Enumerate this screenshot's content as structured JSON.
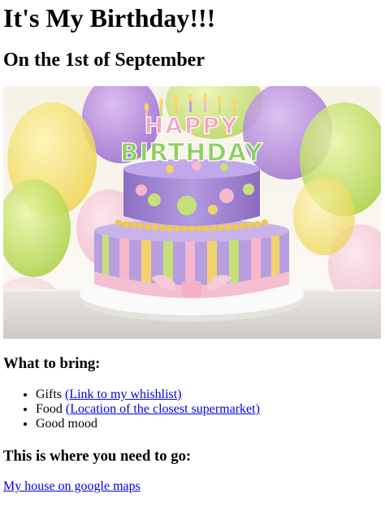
{
  "page": {
    "title": "It's My Birthday!!!",
    "subtitle": "On the 1st of September"
  },
  "hero_image": {
    "topper_line1": "HAPPY",
    "topper_line2": "BIRTHDAY",
    "colors": {
      "cake_purple": "#a58ad6",
      "cake_green": "#c6e07a",
      "cake_pink": "#f4b7cc",
      "cake_yellow": "#f2d36b",
      "plate": "#f6f6f6"
    }
  },
  "bring": {
    "heading": "What to bring:",
    "items": [
      {
        "text": "Gifts ",
        "link": "(Link to my whishlist)"
      },
      {
        "text": "Food ",
        "link": "(Location of the closest supermarket)"
      },
      {
        "text": "Good mood",
        "link": ""
      }
    ]
  },
  "directions": {
    "heading": "This is where you need to go:",
    "link": "My house on google maps"
  },
  "colors": {
    "link": "#0000ee",
    "text": "#000000",
    "background": "#ffffff"
  }
}
